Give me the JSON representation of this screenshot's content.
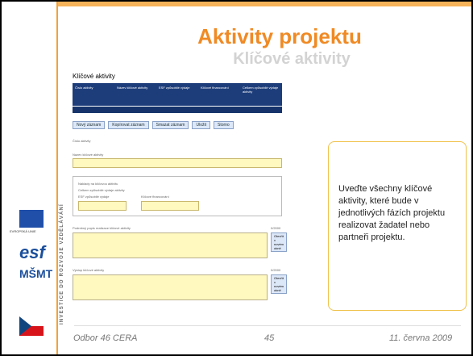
{
  "title": "Aktivity projektu",
  "subtitle": "Klíčové aktivity",
  "form": {
    "heading": "Klíčové aktivity",
    "columns": [
      "Číslo aktivity",
      "Název klíčové aktivity",
      "ESF způsobilé výdaje",
      "Klíčové financování",
      "Celkem způsobilé výdaje aktivity"
    ],
    "buttons": [
      "Nový záznam",
      "Kopírovat záznam",
      "Smazat záznam",
      "Uložit",
      "Storno"
    ],
    "labels": {
      "activity_number": "Číslo aktivity",
      "activity_name": "Název klíčové aktivity",
      "costs_title": "Náklady na klíčovou aktivitu",
      "eligible_total": "Celkem způsobilé výdaje aktivity",
      "esf_eligible": "ESF způsobilé výdaje",
      "key_funding": "Klíčové financování",
      "description": "Podrobný popis realizace klíčové aktivity",
      "output": "Výstup klíčové aktivity",
      "counter1": "0/2000",
      "counter2": "0/2000",
      "open_window": "Otevřít v novém okně"
    }
  },
  "note": "Uveďte všechny klíčové aktivity, které bude v jednotlivých fázích projektu realizovat žadatel nebo partneři projektu.",
  "sidebar": {
    "vertical_text": "INVESTICE DO ROZVOJE VZDĚLÁVÁNÍ",
    "eu_label": "EVROPSKÁ UNIE"
  },
  "footer": {
    "left": "Odbor 46 CERA",
    "center": "45",
    "right": "11. června 2009"
  }
}
